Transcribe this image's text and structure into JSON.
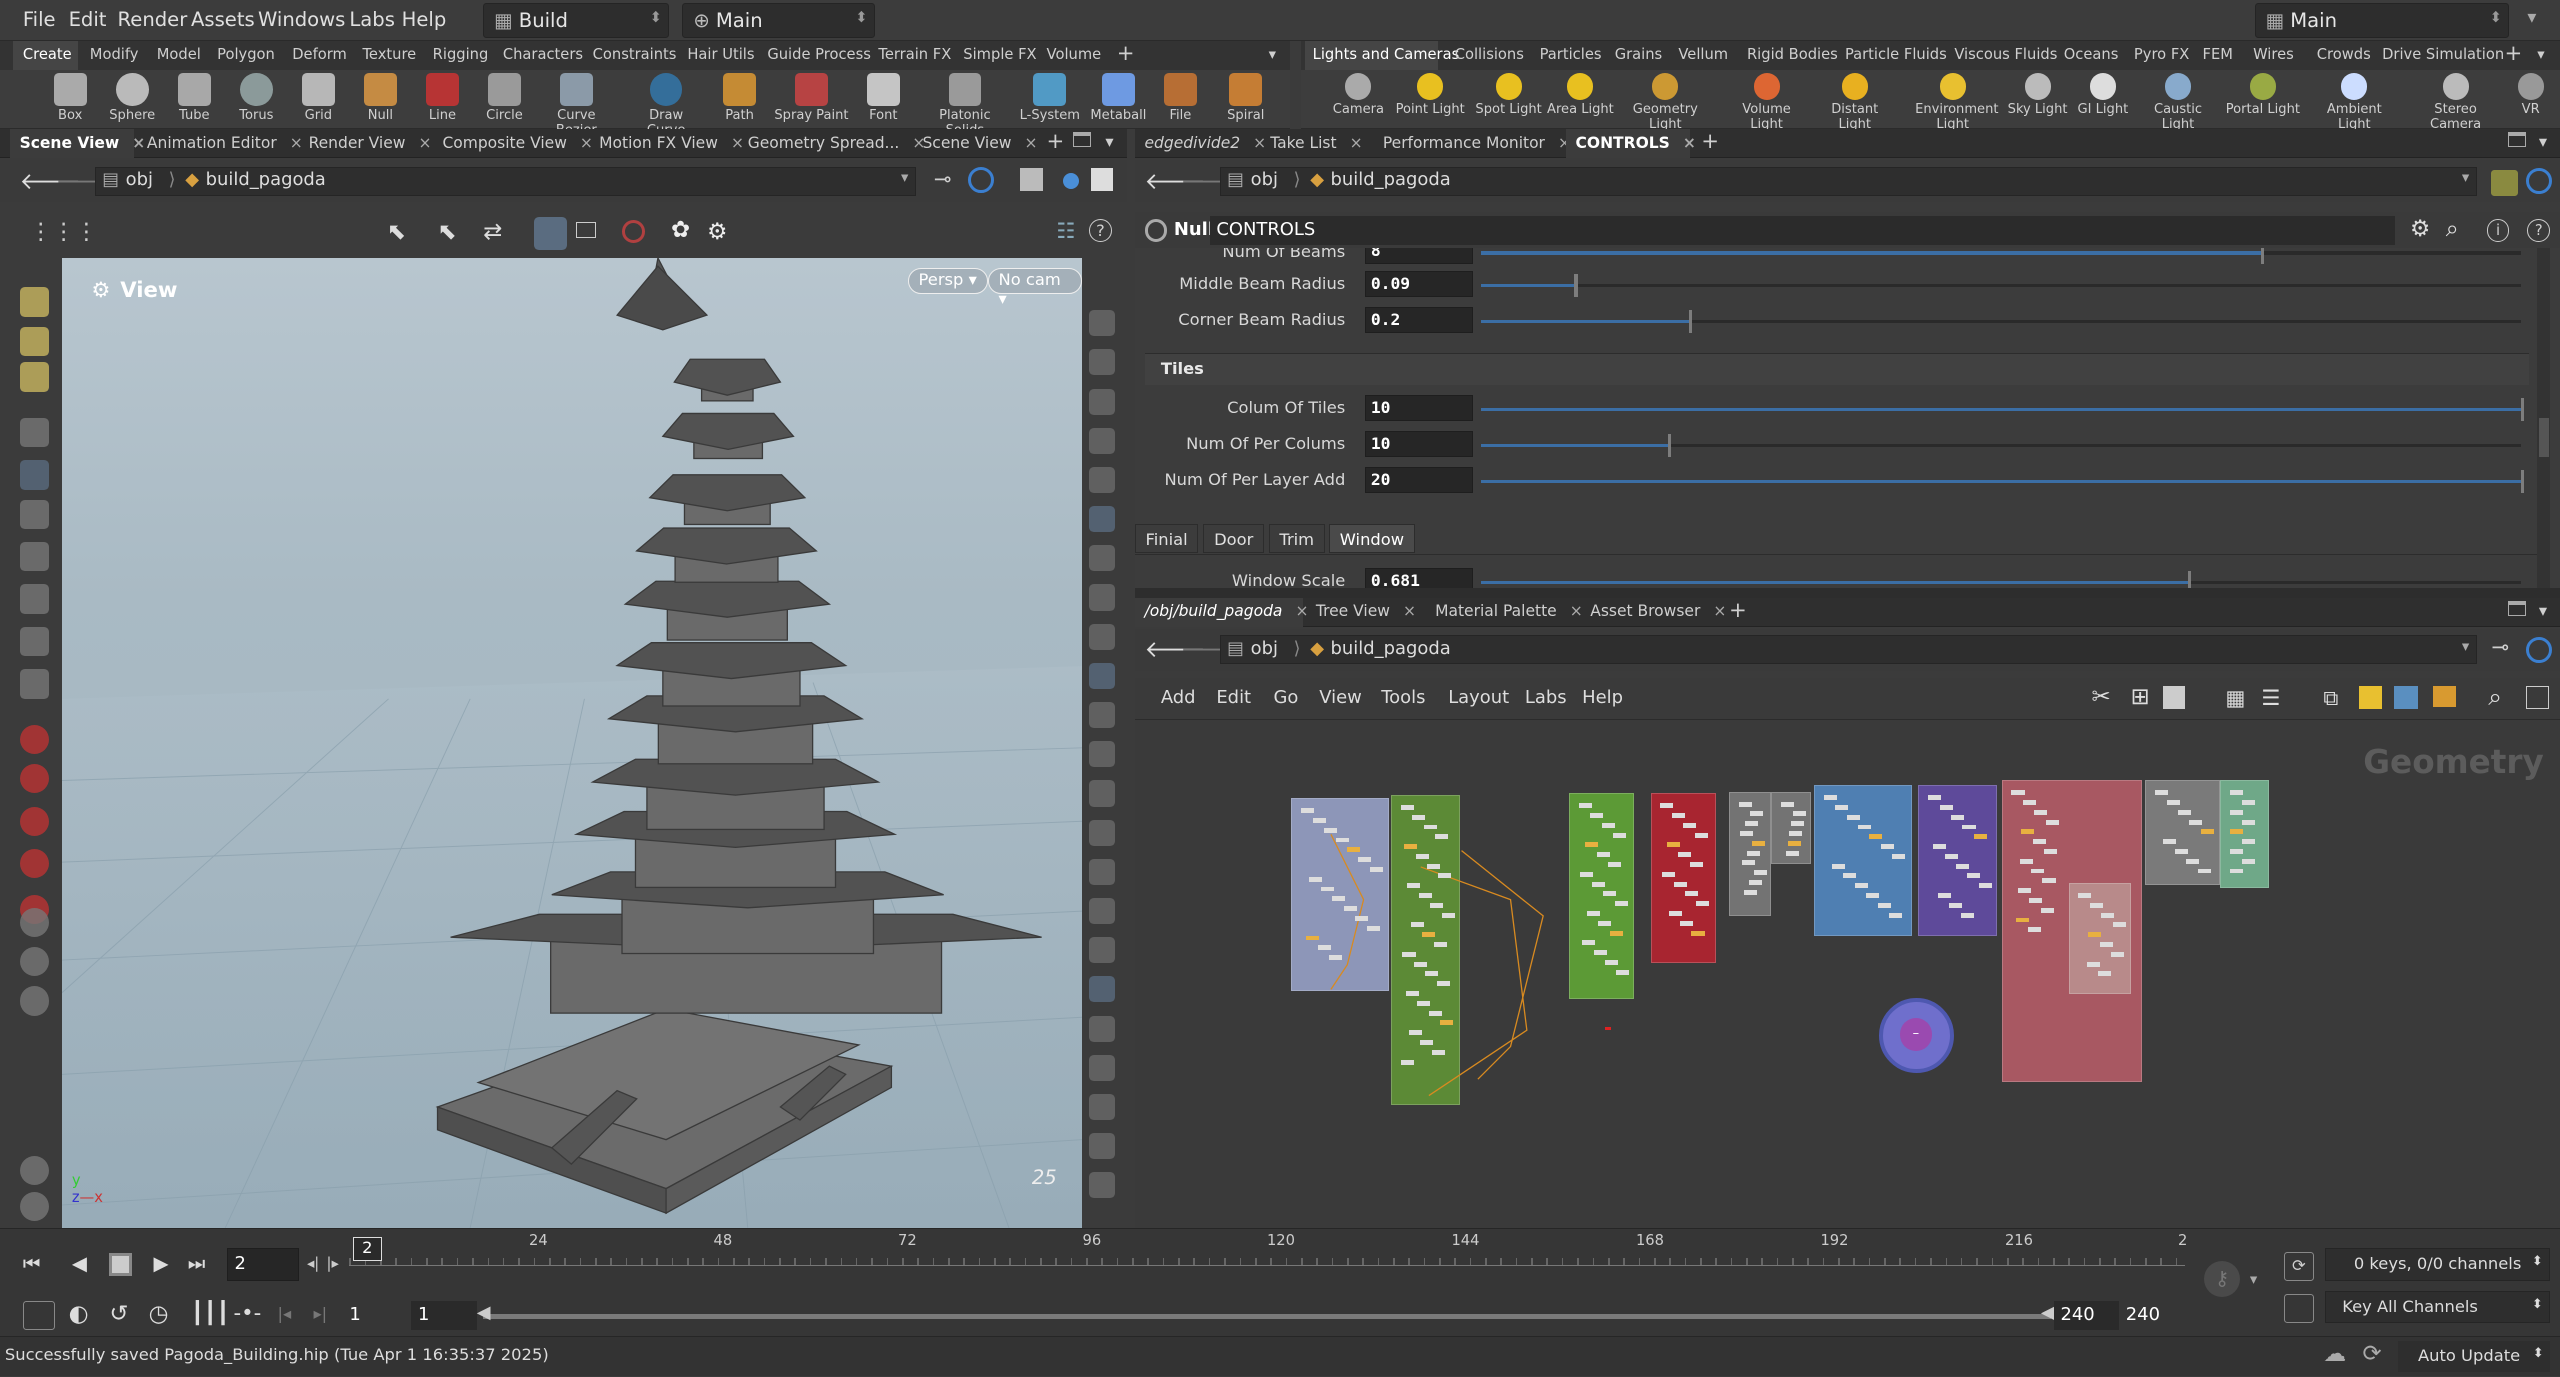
{
  "menubar": {
    "items": [
      "File",
      "Edit",
      "Render",
      "Assets",
      "Windows",
      "Labs",
      "Help"
    ],
    "desktop": "Build",
    "context": "Main",
    "right_desktop": "Main"
  },
  "shelf_tabs_left": [
    "Create",
    "Modify",
    "Model",
    "Polygon",
    "Deform",
    "Texture",
    "Rigging",
    "Characters",
    "Constraints",
    "Hair Utils",
    "Guide Process",
    "Terrain FX",
    "Simple FX",
    "Volume"
  ],
  "shelf_tabs_right": [
    "Lights and Cameras",
    "Collisions",
    "Particles",
    "Grains",
    "Vellum",
    "Rigid Bodies",
    "Particle Fluids",
    "Viscous Fluids",
    "Oceans",
    "Pyro FX",
    "FEM",
    "Wires",
    "Crowds",
    "Drive Simulation"
  ],
  "tools_left": [
    "Box",
    "Sphere",
    "Tube",
    "Torus",
    "Grid",
    "Null",
    "Line",
    "Circle",
    "Curve Bezier",
    "Draw Curve",
    "Path",
    "Spray Paint",
    "Font",
    "Platonic Solids",
    "L-System",
    "Metaball",
    "File",
    "Spiral"
  ],
  "tools_right": [
    "Camera",
    "Point Light",
    "Spot Light",
    "Area Light",
    "Geometry Light",
    "Volume Light",
    "Distant Light",
    "Environment Light",
    "Sky Light",
    "GI Light",
    "Caustic Light",
    "Portal Light",
    "Ambient Light",
    "Stereo Camera",
    "VR"
  ],
  "left_pane_tabs": [
    "Scene View",
    "Animation Editor",
    "Render View",
    "Composite View",
    "Motion FX View",
    "Geometry Spread...",
    "Scene View"
  ],
  "right_top_tabs": [
    "edgedivide2",
    "Take List",
    "Performance Monitor",
    "CONTROLS"
  ],
  "path": {
    "root": "obj",
    "node": "build_pagoda"
  },
  "viewport": {
    "title": "View",
    "persp": "Persp",
    "cam": "No cam",
    "corner_number": "25"
  },
  "params": {
    "node_type": "Null",
    "node_name": "CONTROLS",
    "rows_top": [
      {
        "label": "Num Of Beams",
        "value": "8",
        "frac": 0.75
      },
      {
        "label": "Middle Beam Radius",
        "value": "0.09",
        "frac": 0.09
      },
      {
        "label": "Corner Beam Radius",
        "value": "0.2",
        "frac": 0.2
      }
    ],
    "section": "Tiles",
    "rows_tiles": [
      {
        "label": "Colum Of Tiles",
        "value": "10",
        "frac": 1.0
      },
      {
        "label": "Num Of Per Colums",
        "value": "10",
        "frac": 0.18
      },
      {
        "label": "Num Of Per Layer Add",
        "value": "20",
        "frac": 1.0
      }
    ],
    "folder_tabs": [
      "Finial",
      "Door",
      "Trim",
      "Window"
    ],
    "row_bottom": {
      "label": "Window Scale",
      "value": "0.681",
      "frac": 0.68
    }
  },
  "network": {
    "tabs": [
      "/obj/build_pagoda",
      "Tree View",
      "Material Palette",
      "Asset Browser"
    ],
    "menu": [
      "Add",
      "Edit",
      "Go",
      "View",
      "Tools",
      "Layout",
      "Labs",
      "Help"
    ],
    "context_label": "Geometry"
  },
  "timeline": {
    "frame": "2",
    "ticks": [
      "24",
      "48",
      "72",
      "96",
      "120",
      "144",
      "168",
      "192",
      "216",
      "2"
    ],
    "start": "1",
    "start2": "1",
    "end": "240",
    "end2": "240",
    "keys": "0 keys, 0/0 channels",
    "key_all": "Key All Channels",
    "current_marker": "2"
  },
  "status": {
    "message": "Successfully saved Pagoda_Building.hip (Tue Apr  1 16:35:37 2025)",
    "auto_update": "Auto Update"
  }
}
